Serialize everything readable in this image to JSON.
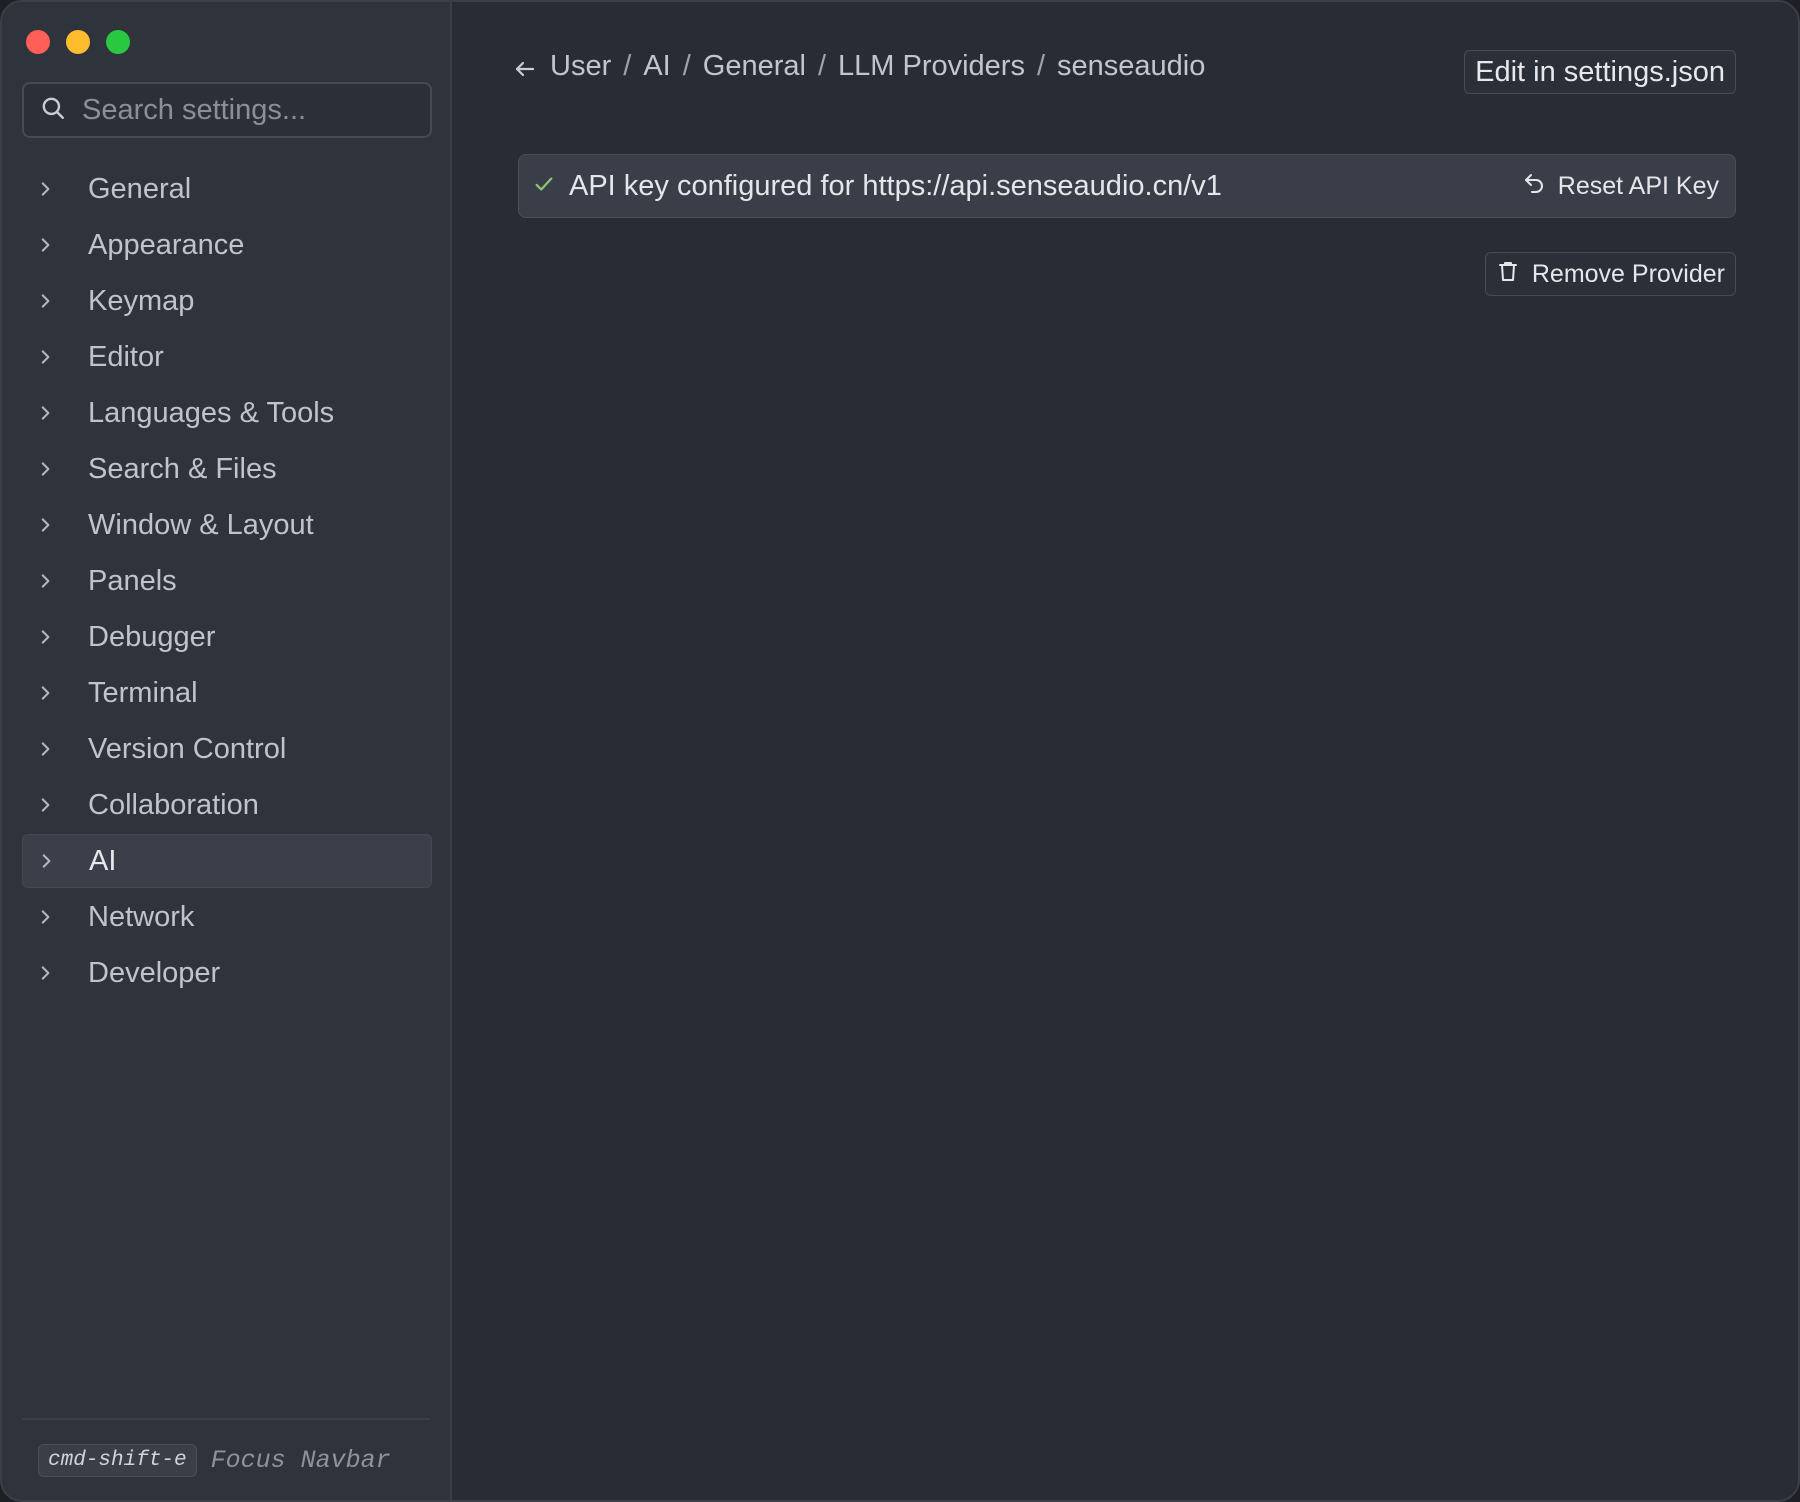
{
  "search": {
    "placeholder": "Search settings..."
  },
  "sidebar": {
    "items": [
      {
        "label": "General"
      },
      {
        "label": "Appearance"
      },
      {
        "label": "Keymap"
      },
      {
        "label": "Editor"
      },
      {
        "label": "Languages & Tools"
      },
      {
        "label": "Search & Files"
      },
      {
        "label": "Window & Layout"
      },
      {
        "label": "Panels"
      },
      {
        "label": "Debugger"
      },
      {
        "label": "Terminal"
      },
      {
        "label": "Version Control"
      },
      {
        "label": "Collaboration"
      },
      {
        "label": "AI",
        "selected": true
      },
      {
        "label": "Network"
      },
      {
        "label": "Developer"
      }
    ],
    "footer": {
      "shortcut": "cmd-shift-e",
      "label": "Focus Navbar"
    }
  },
  "header": {
    "breadcrumb": [
      "User",
      "AI",
      "General",
      "LLM Providers",
      "senseaudio"
    ],
    "separator": "/",
    "edit_json_label": "Edit in settings.json"
  },
  "api_status": {
    "message": "API key configured for https://api.senseaudio.cn/v1",
    "reset_label": "Reset API Key"
  },
  "actions": {
    "remove_provider_label": "Remove Provider"
  },
  "colors": {
    "check": "#8fc370",
    "traffic_red": "#fe5f57",
    "traffic_yellow": "#febc2e",
    "traffic_green": "#28c840"
  }
}
